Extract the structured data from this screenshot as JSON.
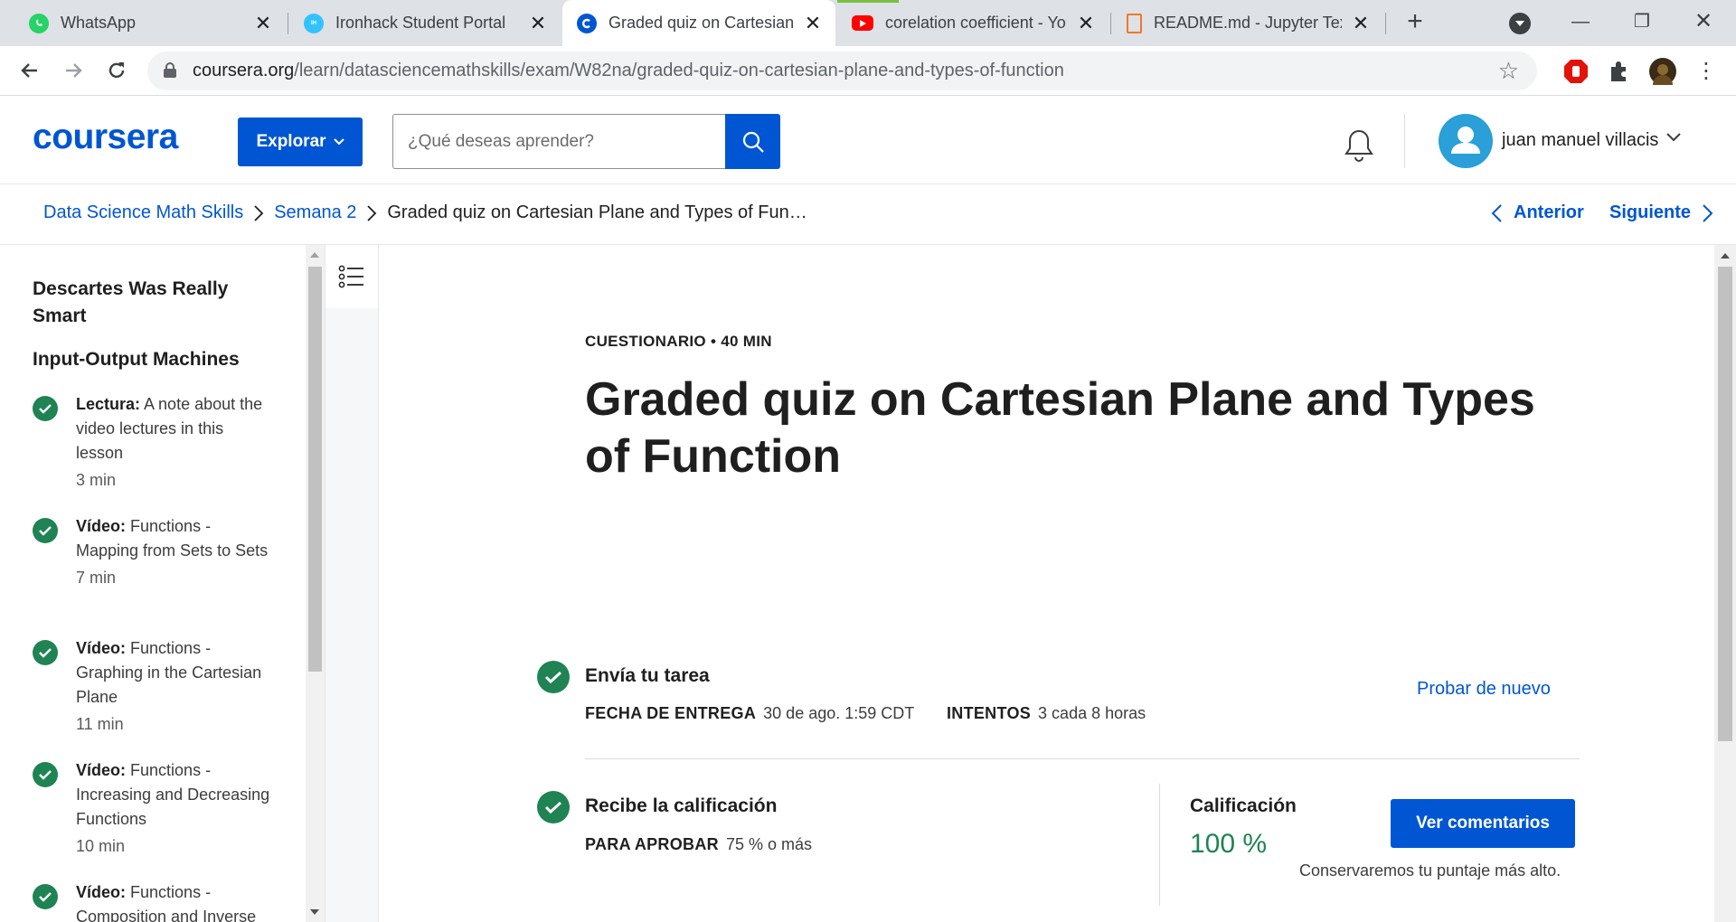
{
  "browser": {
    "tabs": [
      {
        "title": "WhatsApp",
        "icon": "whatsapp-icon",
        "color": "#25d366"
      },
      {
        "title": "Ironhack Student Portal",
        "icon": "ironhack-icon",
        "color": "#32c3ff"
      },
      {
        "title": "Graded quiz on Cartesian",
        "icon": "coursera-icon",
        "color": "#0056d2"
      },
      {
        "title": "corelation coefficient - You",
        "icon": "youtube-icon",
        "color": "#ff0000"
      },
      {
        "title": "README.md - Jupyter Tex",
        "icon": "jupyter-file-icon",
        "color": "#f37726"
      }
    ],
    "active_tab": 2,
    "url_domain": "coursera.org",
    "url_path": "/learn/datasciencemathskills/exam/W82na/graded-quiz-on-cartesian-plane-and-types-of-function"
  },
  "header": {
    "logo": "coursera",
    "explore_label": "Explorar",
    "search_placeholder": "¿Qué deseas aprender?",
    "user_name": "juan manuel villacis"
  },
  "breadcrumb": {
    "course": "Data Science Math Skills",
    "week": "Semana 2",
    "current": "Graded quiz on Cartesian Plane and Types of Fun…",
    "prev_label": "Anterior",
    "next_label": "Siguiente"
  },
  "sidebar": {
    "lessons": [
      "Descartes Was Really Smart",
      "Input-Output Machines"
    ],
    "items": [
      {
        "type": "Lectura:",
        "name": "A note about the video lectures in this lesson",
        "duration": "3 min",
        "completed": true
      },
      {
        "type": "Vídeo:",
        "name": "Functions - Mapping from Sets to Sets",
        "duration": "7 min",
        "completed": true
      },
      {
        "type": "Vídeo:",
        "name": "Functions - Graphing in the Cartesian Plane",
        "duration": "11 min",
        "completed": true
      },
      {
        "type": "Vídeo:",
        "name": "Functions - Increasing and Decreasing Functions",
        "duration": "10 min",
        "completed": true
      },
      {
        "type": "Vídeo:",
        "name": "Functions - Composition and Inverse",
        "duration": "",
        "completed": true
      }
    ]
  },
  "main": {
    "eyebrow": "CUESTIONARIO • 40 MIN",
    "title": "Graded quiz on Cartesian Plane and Types of Function",
    "submit": {
      "title": "Envía tu tarea",
      "due_label": "FECHA DE ENTREGA",
      "due_value": "30 de ago. 1:59 CDT",
      "attempts_label": "INTENTOS",
      "attempts_value": "3 cada 8 horas",
      "retry_label": "Probar de nuevo"
    },
    "grade": {
      "title": "Recibe la calificación",
      "pass_label": "PARA APROBAR",
      "pass_value": "75 % o más",
      "grade_label": "Calificación",
      "grade_value": "100 %",
      "feedback_label": "Ver comentarios",
      "note": "Conservaremos tu puntaje más alto."
    }
  },
  "colors": {
    "brand": "#0056d2",
    "success": "#1f8354"
  }
}
